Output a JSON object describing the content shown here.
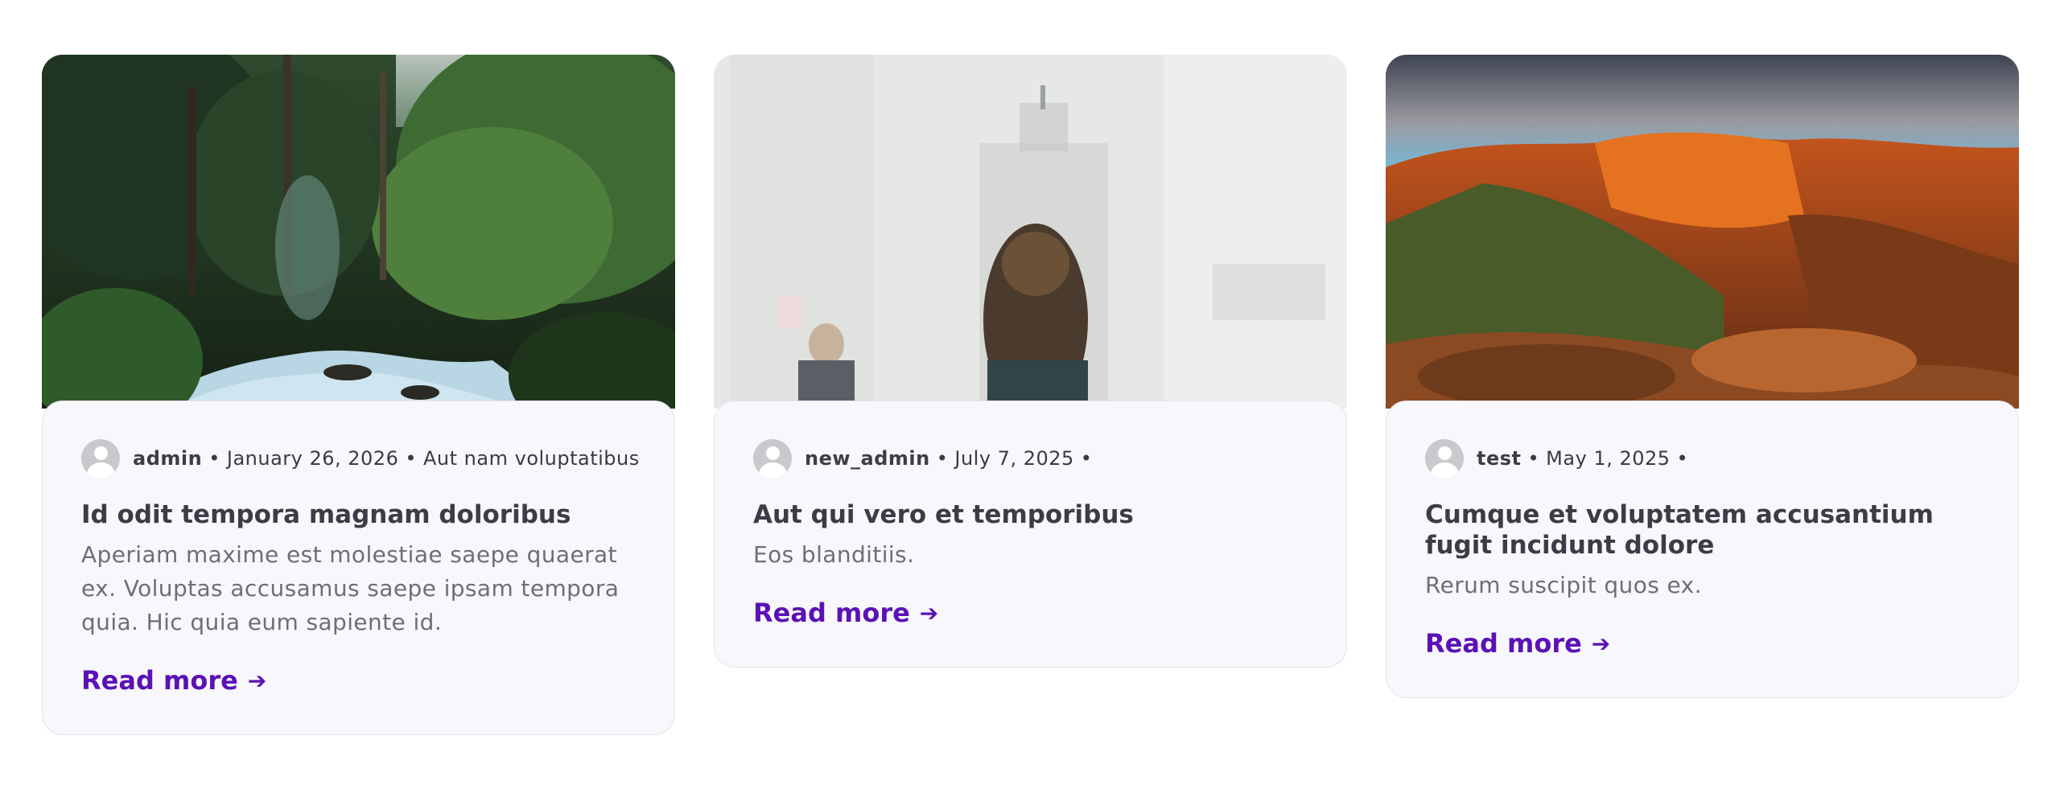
{
  "posts": [
    {
      "image_alt": "forest stream",
      "author": "admin",
      "date": "January 26, 2026",
      "category": "Aut nam voluptatibus",
      "title": "Id odit tempora magnam doloribus",
      "excerpt": "Aperiam maxime est molestiae saepe quaerat ex. Voluptas accusamus saepe ipsam tempora quia. Hic quia eum sapiente id.",
      "read_more": "Read more",
      "separator": "•"
    },
    {
      "image_alt": "city double exposure",
      "author": "new_admin",
      "date": "July 7, 2025",
      "category": "",
      "title": "Aut qui vero et temporibus",
      "excerpt": "Eos blanditiis.",
      "read_more": "Read more",
      "separator": "•"
    },
    {
      "image_alt": "canyon at sunset",
      "author": "test",
      "date": "May 1, 2025",
      "category": "",
      "title": "Cumque et voluptatem accusantium fugit incidunt dolore",
      "excerpt": "Rerum suscipit quos ex.",
      "read_more": "Read more",
      "separator": "•"
    }
  ],
  "icons": {
    "avatar": "default-user-avatar-icon",
    "read_more_arrow": "arrow-right-icon"
  },
  "colors": {
    "accent": "#5b11b5",
    "card_background": "#f8f7fb",
    "title": "#3e3b47",
    "excerpt": "#6f6d78"
  }
}
